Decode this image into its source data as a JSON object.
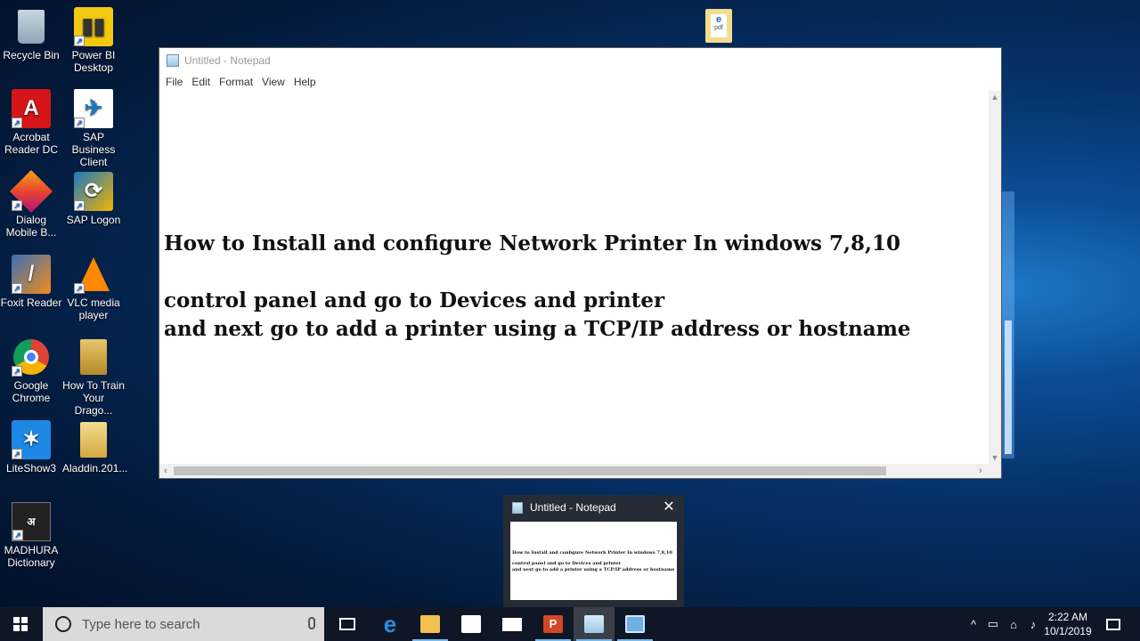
{
  "desktop": {
    "icons": [
      {
        "label": "Recycle Bin",
        "icon": "recycle-bin-icon",
        "color": "#8fa4b6"
      },
      {
        "label": "Power BI Desktop",
        "icon": "power-bi-icon",
        "color": "#f2c811"
      },
      {
        "label": "Acrobat Reader DC",
        "icon": "acrobat-icon",
        "color": "#d4151a"
      },
      {
        "label": "SAP Business Client",
        "icon": "sap-business-client-icon",
        "color": "#ffffff"
      },
      {
        "label": "Dialog Mobile B...",
        "icon": "dialog-mobile-icon",
        "color": "#e8452c"
      },
      {
        "label": "SAP Logon",
        "icon": "sap-logon-icon",
        "color": "#f4b400"
      },
      {
        "label": "Foxit Reader",
        "icon": "foxit-reader-icon",
        "color": "#f28c1c"
      },
      {
        "label": "VLC media player",
        "icon": "vlc-icon",
        "color": "#ff8800"
      },
      {
        "label": "Google Chrome",
        "icon": "chrome-icon",
        "color": "#4285f4"
      },
      {
        "label": "How To Train Your Drago...",
        "icon": "folder-icon",
        "color": "#e8c56a"
      },
      {
        "label": "LiteShow3",
        "icon": "liteshow-icon",
        "color": "#1e88e5"
      },
      {
        "label": "Aladdin.201...",
        "icon": "folder-icon",
        "color": "#e8c56a"
      },
      {
        "label": "MADHURA Dictionary",
        "icon": "madhura-dictionary-icon",
        "color": "#222222"
      }
    ],
    "pdf_file_icon": "pdf-edge-file-icon"
  },
  "notepad": {
    "title": "Untitled - Notepad",
    "menu": [
      "File",
      "Edit",
      "Format",
      "View",
      "Help"
    ],
    "lines": [
      "How to Install and configure Network Printer In windows 7,8,10",
      "control panel and go to Devices and printer",
      "and next go to add a printer using a TCP/IP address or hostname"
    ]
  },
  "preview": {
    "title": "Untitled - Notepad"
  },
  "taskbar": {
    "search_placeholder": "Type here to search",
    "apps": [
      {
        "name": "task-view",
        "icon": "task-view-icon"
      },
      {
        "name": "edge",
        "icon": "edge-icon"
      },
      {
        "name": "file-explorer",
        "icon": "file-explorer-icon"
      },
      {
        "name": "store",
        "icon": "store-icon"
      },
      {
        "name": "mail",
        "icon": "mail-icon"
      },
      {
        "name": "powerpoint",
        "icon": "powerpoint-icon"
      },
      {
        "name": "notepad",
        "icon": "notepad-icon"
      },
      {
        "name": "app-window",
        "icon": "app-window-icon"
      }
    ],
    "time": "2:22 AM",
    "date": "10/1/2019"
  }
}
